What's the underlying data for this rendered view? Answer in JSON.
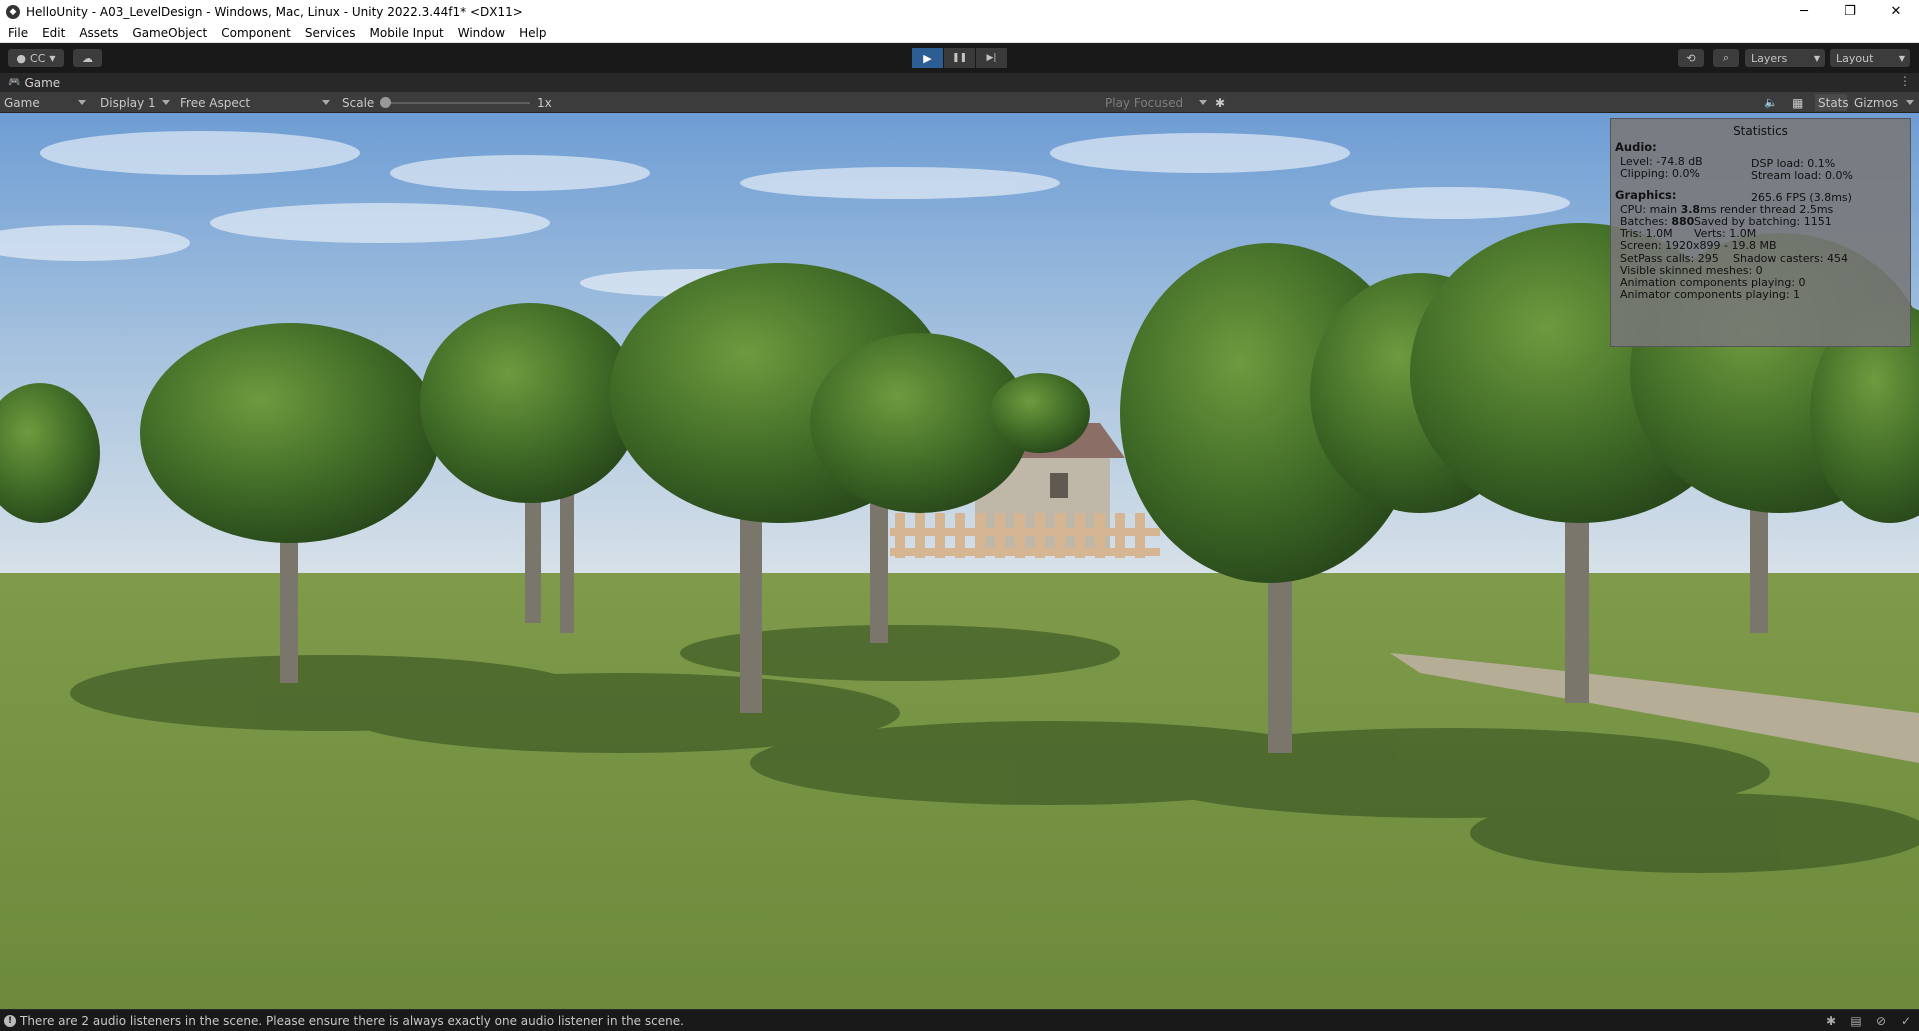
{
  "window": {
    "title": "HelloUnity - A03_LevelDesign - Windows, Mac, Linux - Unity 2022.3.44f1* <DX11>",
    "controls": {
      "minimize": "─",
      "restore": "❐",
      "close": "✕"
    }
  },
  "menu": [
    "File",
    "Edit",
    "Assets",
    "GameObject",
    "Component",
    "Services",
    "Mobile Input",
    "Window",
    "Help"
  ],
  "toolbar": {
    "account_label": "CC",
    "play_icon": "▶",
    "pause_icon": "❚❚",
    "step_icon": "▶|",
    "history_icon": "⟲",
    "search_icon": "⌕",
    "layers_label": "Layers",
    "layout_label": "Layout"
  },
  "game_tab": {
    "label": "Game",
    "more": "⋮"
  },
  "game_toolbar": {
    "view_select": "Game",
    "display_select": "Display 1",
    "aspect_select": "Free Aspect",
    "scale_label": "Scale",
    "scale_value": "1x",
    "play_mode_select": "Play Focused",
    "mute_icon": "🔈",
    "stats_label": "Stats",
    "gizmos_label": "Gizmos"
  },
  "stats": {
    "title": "Statistics",
    "audio_header": "Audio:",
    "level": "Level: -74.8 dB",
    "clipping": "Clipping: 0.0%",
    "dsp_load": "DSP load: 0.1%",
    "stream_load": "Stream load: 0.0%",
    "graphics_header": "Graphics:",
    "fps": "265.6 FPS (3.8ms)",
    "cpu_prefix": "CPU: main ",
    "cpu_main": "3.8",
    "cpu_suffix": "ms  render thread 2.5ms",
    "batches_prefix": "Batches: ",
    "batches_value": "880",
    "saved_batching": "Saved by batching: 1151",
    "tris": "Tris: 1.0M",
    "verts": "Verts: 1.0M",
    "screen": "Screen: 1920x899 - 19.8 MB",
    "setpass": "SetPass calls: 295",
    "shadow_casters": "Shadow casters: 454",
    "skinned_meshes": "Visible skinned meshes: 0",
    "animation_components": "Animation components playing: 0",
    "animator_components": "Animator components playing: 1"
  },
  "status": {
    "message": "There are 2 audio listeners in the scene. Please ensure there is always exactly one audio listener in the scene.",
    "info_icon": "!"
  },
  "colors": {
    "accent_play": "#2d5e93",
    "editor_dark": "#191919",
    "panel": "#3c3c3c"
  }
}
